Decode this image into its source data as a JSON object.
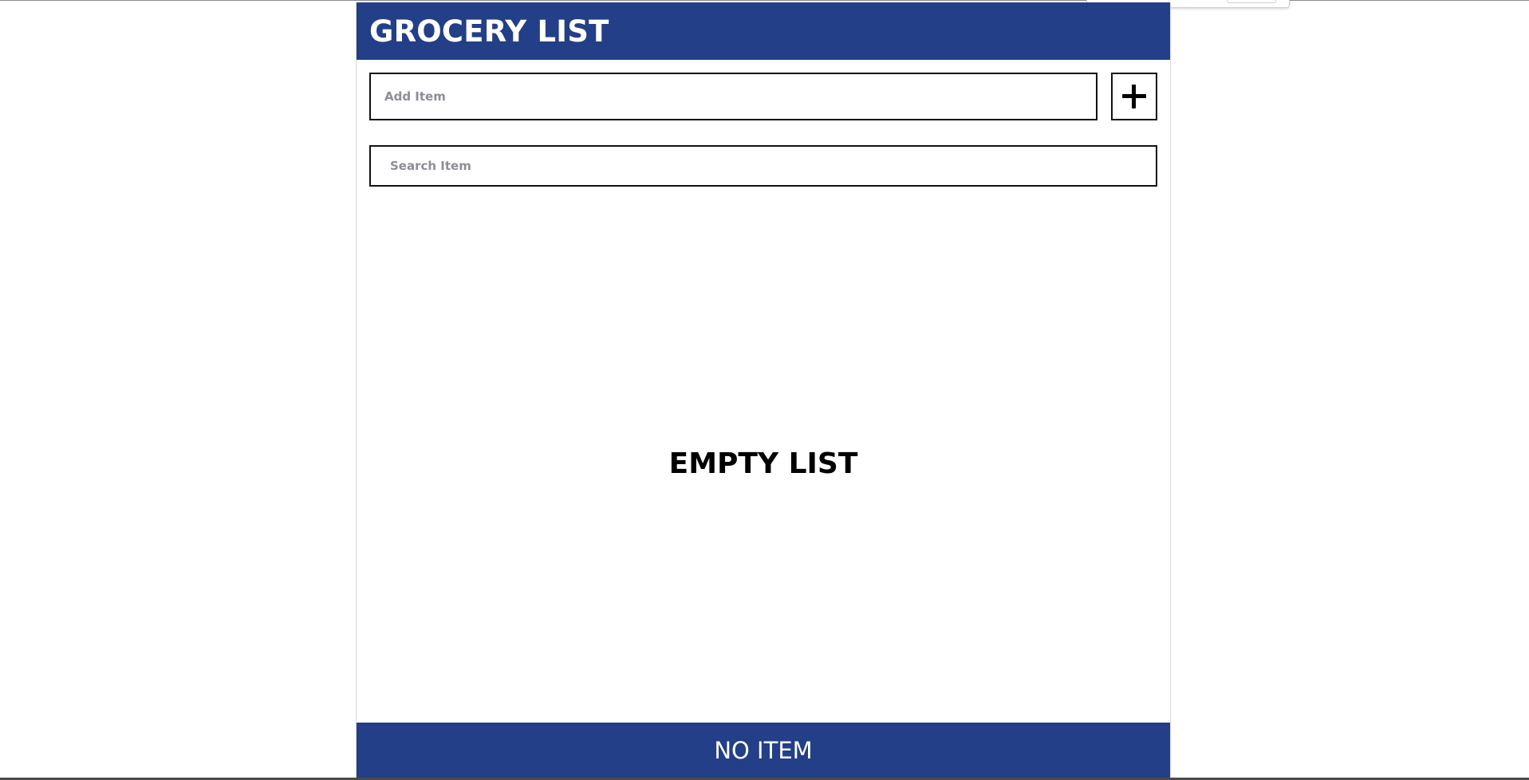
{
  "app": {
    "title": "GROCERY LIST"
  },
  "add_item": {
    "placeholder": "Add Item",
    "value": "",
    "button_icon": "plus-icon"
  },
  "search": {
    "placeholder": "Search Item",
    "value": ""
  },
  "list": {
    "items": [],
    "empty_message": "EMPTY LIST"
  },
  "footer": {
    "status": "NO ITEM"
  },
  "colors": {
    "header_background": "#223f87",
    "footer_background": "#223f87",
    "text_on_brand": "#ffffff",
    "input_border": "#111111",
    "placeholder": "#8d8d95"
  }
}
